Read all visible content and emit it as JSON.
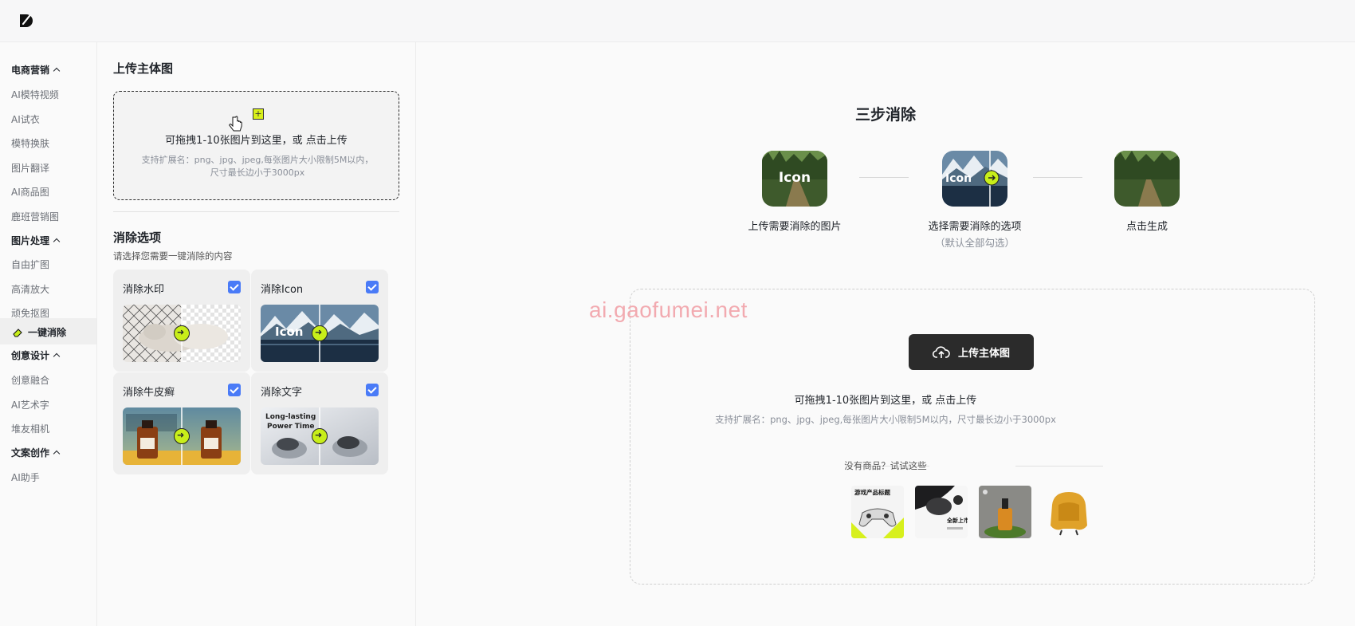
{
  "sidebar": {
    "groups": [
      {
        "label": "电商营销",
        "items": [
          "AI模特视频",
          "AI试衣",
          "模特换肤",
          "图片翻译",
          "AI商品图",
          "鹿班营销图"
        ]
      },
      {
        "label": "图片处理",
        "items": [
          "自由扩图",
          "高清放大",
          "顽免抠图",
          "一键消除"
        ]
      },
      {
        "label": "创意设计",
        "items": [
          "创意融合",
          "AI艺术字",
          "堆友相机"
        ]
      },
      {
        "label": "文案创作",
        "items": [
          "AI助手"
        ]
      }
    ],
    "active_item": "一键消除"
  },
  "panel": {
    "upload_title": "上传主体图",
    "dropzone_plus": "+",
    "dropzone_main": "可拖拽1-10张图片到这里，或 点击上传",
    "dropzone_sub": "支持扩展名：png、jpg、jpeg,每张图片大小限制5M以内，尺寸最长边小于3000px",
    "options_title": "消除选项",
    "options_desc": "请选择您需要一键消除的内容",
    "options": [
      {
        "label": "消除水印",
        "checked": true
      },
      {
        "label": "消除Icon",
        "checked": true
      },
      {
        "label": "消除牛皮癣",
        "checked": true
      },
      {
        "label": "消除文字",
        "checked": true
      }
    ],
    "card_image_texts": {
      "icon": "Icon",
      "text_line1": "Long-lasting",
      "text_line2": "Power Time"
    }
  },
  "main": {
    "title": "三步消除",
    "steps": [
      {
        "label": "上传需要消除的图片",
        "image_text": "Icon"
      },
      {
        "label": "选择需要消除的选项",
        "note": "（默认全部勾选）",
        "image_text": "Icon"
      },
      {
        "label": "点击生成"
      }
    ],
    "watermark": "ai.gaofumei.net",
    "upload_button": "上传主体图",
    "upload_hint": "可拖拽1-10张图片到这里，或 点击上传",
    "upload_sub": "支持扩展名：png、jpg、jpeg,每张图片大小限制5M以内，尺寸最长边小于3000px",
    "try_label": "没有商品？试试这些",
    "samples": [
      "game-controller-sample",
      "earbuds-sample",
      "serum-bottle-sample",
      "armchair-sample"
    ],
    "sample_texts": {
      "game": "游戏产品标题",
      "earbuds": "全新上市"
    }
  },
  "colors": {
    "accent": "#c8ee1a",
    "check": "#4a7bf7",
    "button": "#2b2b2b"
  }
}
